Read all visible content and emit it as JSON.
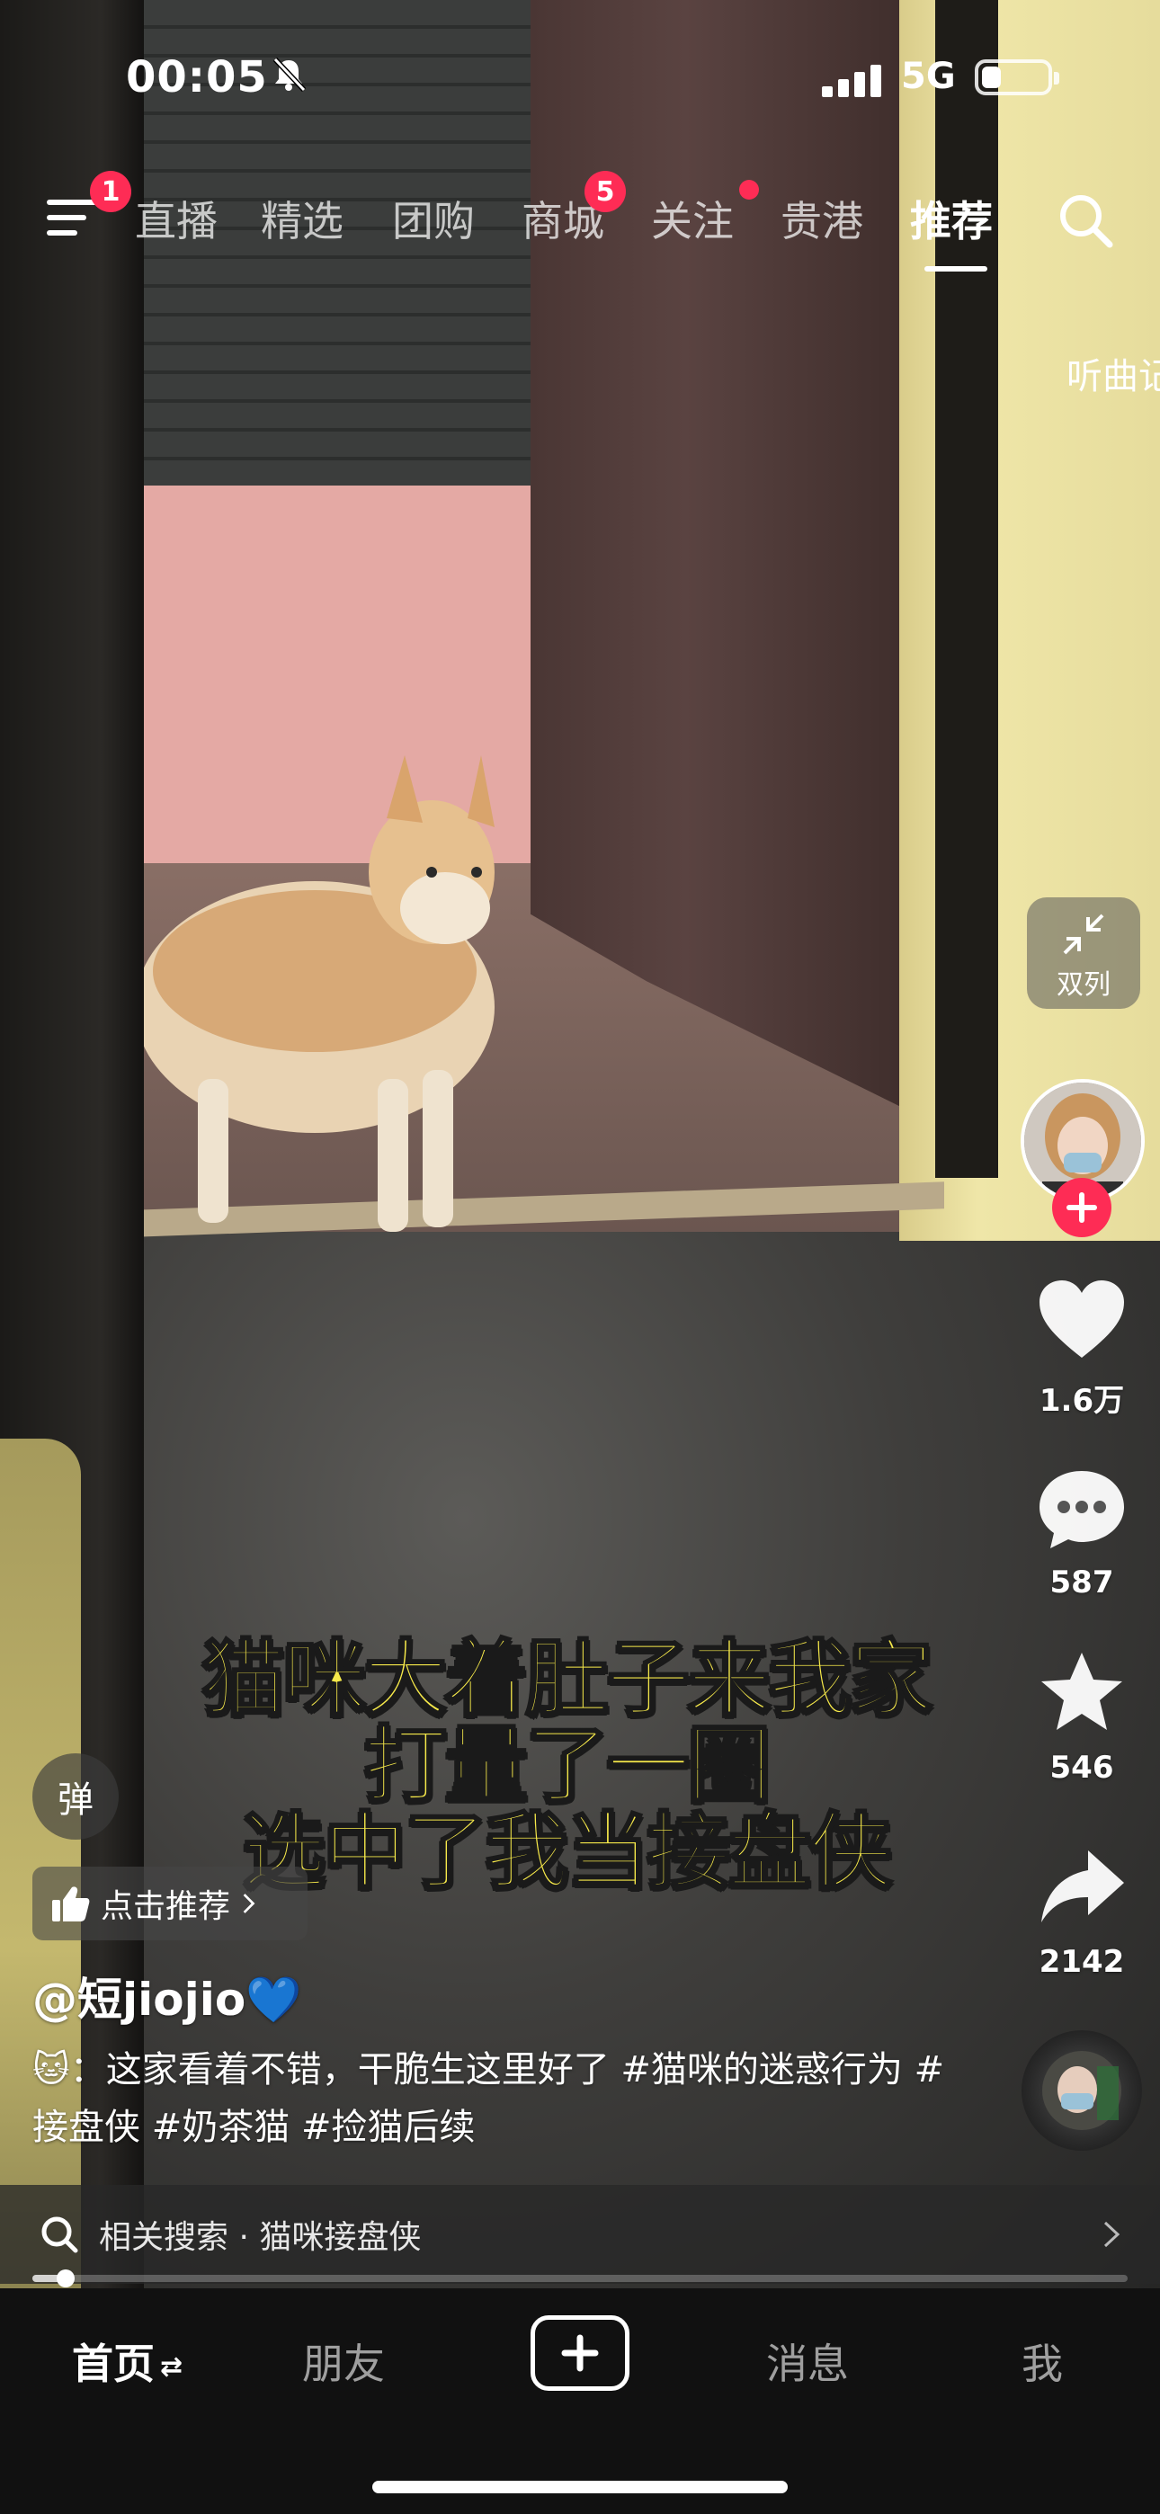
{
  "status_bar": {
    "time": "00:05",
    "network": "5G",
    "battery_level": 0.3
  },
  "nav": {
    "menu_badge": "1",
    "tabs": [
      {
        "label": "直播"
      },
      {
        "label": "精选"
      },
      {
        "label": "团购"
      },
      {
        "label": "商城",
        "badge": "5"
      },
      {
        "label": "关注"
      },
      {
        "label": "贵港"
      },
      {
        "label": "推荐",
        "active": true
      }
    ],
    "side_hint": "听曲记"
  },
  "video": {
    "caption_lines": [
      "猫咪大着肚子来我家",
      "打量了一圈",
      "选中了我当接盘侠"
    ]
  },
  "rail": {
    "dual_label": "双列",
    "likes": "1.6万",
    "comments": "587",
    "favorites": "546",
    "shares": "2142"
  },
  "info": {
    "danmu_label": "弹",
    "recommend_label": "点击推荐",
    "author": "@短jiojio💙",
    "description": "🐱：这家看着不错，干脆生这里好了 #猫咪的迷惑行为 #接盘侠 #奶茶猫 #捡猫后续"
  },
  "related_search": {
    "text": "相关搜索 · 猫咪接盘侠"
  },
  "progress": 0.03,
  "tabbar": {
    "home": "首页",
    "friends": "朋友",
    "messages": "消息",
    "me": "我"
  },
  "colors": {
    "accent": "#fe2c55",
    "caption": "#f6e94a"
  },
  "icons": [
    "bell-off-icon",
    "menu-icon",
    "search-icon",
    "collapse-icon",
    "heart-icon",
    "comment-icon",
    "star-icon",
    "share-icon",
    "thumb-up-icon",
    "plus-icon",
    "chevron-right-icon"
  ]
}
